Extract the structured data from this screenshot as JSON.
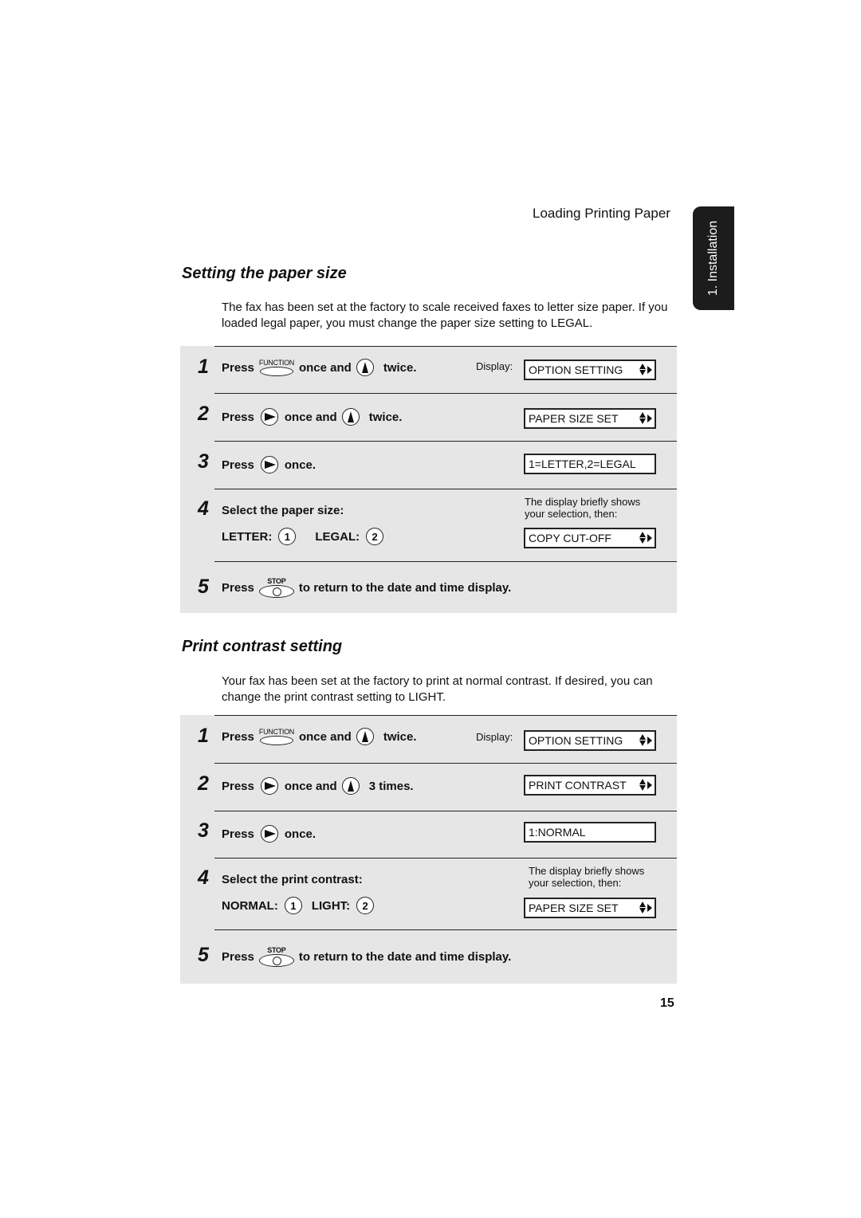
{
  "header": {
    "title": "Loading Printing Paper",
    "side_tab": "1. Installation"
  },
  "sections": [
    {
      "title": "Setting the paper size",
      "intro": "The fax has been set at the factory to scale received faxes to letter size paper. If you loaded legal paper, you must change the paper size setting to LEGAL.",
      "display_label": "Display:",
      "steps": [
        {
          "num": "1",
          "press": "Press",
          "button": "FUNCTION",
          "mid": "once and",
          "end": "twice.",
          "display": "OPTION SETTING"
        },
        {
          "num": "2",
          "press": "Press",
          "mid": "once and",
          "end": "twice.",
          "display": "PAPER SIZE SET"
        },
        {
          "num": "3",
          "press": "Press",
          "end": "once.",
          "display": "1=LETTER,2=LEGAL"
        },
        {
          "num": "4",
          "text": "Select the paper size:",
          "opt1_label": "LETTER:",
          "opt1_key": "1",
          "opt2_label": "LEGAL:",
          "opt2_key": "2",
          "note": "The display briefly shows your selection, then:",
          "display": "COPY CUT-OFF"
        },
        {
          "num": "5",
          "press": "Press",
          "button": "STOP",
          "end": "to return to the date and time display."
        }
      ]
    },
    {
      "title": "Print contrast setting",
      "intro": "Your fax has been set at the factory to print at normal contrast. If desired, you can change the print contrast setting to LIGHT.",
      "display_label": "Display:",
      "steps": [
        {
          "num": "1",
          "press": "Press",
          "button": "FUNCTION",
          "mid": "once and",
          "end": "twice.",
          "display": "OPTION SETTING"
        },
        {
          "num": "2",
          "press": "Press",
          "mid": "once and",
          "end": "3 times.",
          "display": "PRINT CONTRAST"
        },
        {
          "num": "3",
          "press": "Press",
          "end": "once.",
          "display": "1:NORMAL"
        },
        {
          "num": "4",
          "text": "Select the print contrast:",
          "opt1_label": "NORMAL:",
          "opt1_key": "1",
          "opt2_label": "LIGHT:",
          "opt2_key": "2",
          "note": "The display briefly shows your selection, then:",
          "display": "PAPER SIZE SET"
        },
        {
          "num": "5",
          "press": "Press",
          "button": "STOP",
          "end": "to return to the date and time display."
        }
      ]
    }
  ],
  "page_number": "15"
}
